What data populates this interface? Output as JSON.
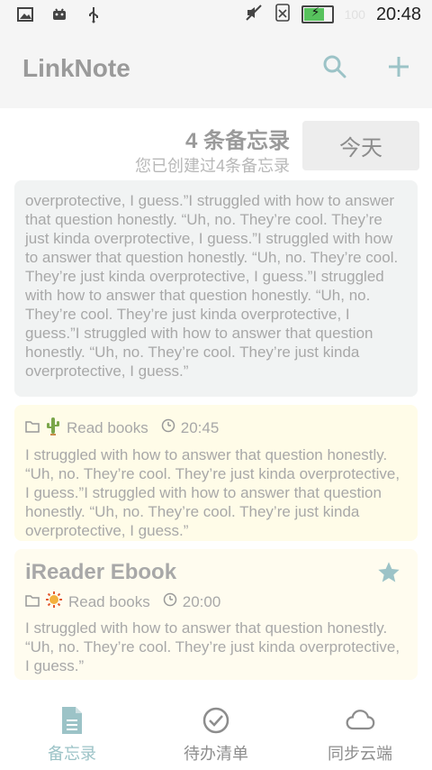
{
  "status_bar": {
    "time": "20:48",
    "battery_text": "100"
  },
  "app": {
    "title": "LinkNote"
  },
  "header": {
    "count_text": "4 条备忘录",
    "subtitle": "您已创建过4条备忘录",
    "today_button": "今天"
  },
  "cards": [
    {
      "body": "overprotective, I guess.”I struggled with how to answer that question honestly. “Uh, no. They’re cool. They’re just kinda overprotective, I guess.”I struggled with how to answer that question honestly. “Uh, no. They’re cool. They’re just kinda overprotective, I guess.”I struggled with how to answer that question honestly. “Uh, no. They’re cool. They’re just kinda overprotective, I guess.”I struggled with how to answer that question honestly. “Uh, no. They’re cool. They’re just kinda overprotective, I guess.”"
    },
    {
      "folder": "Read books",
      "time": "20:45",
      "body": "I struggled with how to answer that question honestly. “Uh, no. They’re cool. They’re just kinda overprotective, I guess.”I struggled with how to answer that question honestly. “Uh, no. They’re cool. They’re just kinda overprotective, I guess.”"
    },
    {
      "title": "iReader Ebook",
      "folder": "Read books",
      "time": "20:00",
      "body": "I struggled with how to answer that question honestly. “Uh, no. They’re cool. They’re just kinda overprotective, I guess.”"
    }
  ],
  "bottom_nav": [
    {
      "label": "备忘录",
      "icon": "document-icon",
      "active": true
    },
    {
      "label": "待办清单",
      "icon": "check-circle-icon",
      "active": false
    },
    {
      "label": "同步云端",
      "icon": "cloud-icon",
      "active": false
    }
  ],
  "colors": {
    "accent": "#9cc3c7",
    "card1_bg": "#f1f3f3",
    "card2_bg": "#fffce8",
    "card3_bg": "#fffcef"
  }
}
